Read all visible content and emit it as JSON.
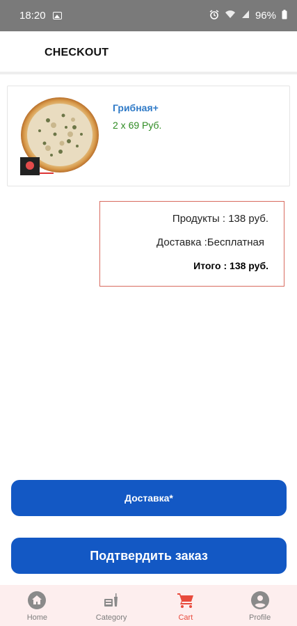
{
  "status_bar": {
    "time": "18:20",
    "battery": "96%",
    "icons": [
      "image-icon",
      "alarm-icon",
      "wifi-icon",
      "signal-icon",
      "battery-icon"
    ]
  },
  "header": {
    "title": "CHECKOUT"
  },
  "cart": {
    "items": [
      {
        "name": "Грибная+",
        "qty_price": "2 x 69 Руб.",
        "image": "pizza-image"
      }
    ]
  },
  "summary": {
    "products": "Продукты : 138 руб.",
    "delivery": "Доставка :Бесплатная",
    "total": "Итого : 138 руб."
  },
  "buttons": {
    "delivery_label": "Доставка*",
    "confirm_label": "Подтвердить заказ"
  },
  "nav": {
    "items": [
      {
        "label": "Home",
        "icon": "home-icon"
      },
      {
        "label": "Category",
        "icon": "category-icon"
      },
      {
        "label": "Cart",
        "icon": "cart-icon",
        "active": true
      },
      {
        "label": "Profile",
        "icon": "profile-icon"
      }
    ]
  },
  "colors": {
    "accent_blue": "#1358c4",
    "product_name": "#2f7ac7",
    "price_green": "#2e8b22",
    "active_nav": "#e84a3c",
    "summary_border": "#d86a5e"
  }
}
